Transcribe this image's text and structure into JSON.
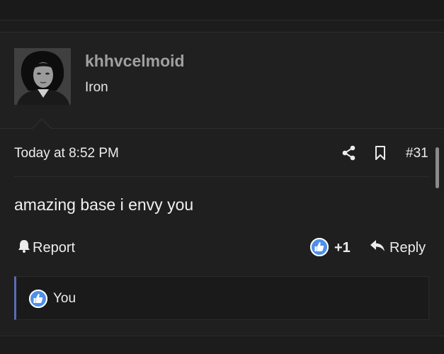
{
  "author": {
    "username": "khhvcelmoid",
    "title": "Iron"
  },
  "post": {
    "timestamp": "Today at 8:52 PM",
    "post_number": "#31",
    "message": "amazing base i envy you"
  },
  "actions": {
    "report_label": "Report",
    "like_count": "+1",
    "reply_label": "Reply"
  },
  "reactions": {
    "by": "You"
  },
  "colors": {
    "background": "#1c1c1c",
    "accent_bar": "#5c6bb5",
    "like_blue": "#3b82f6"
  },
  "icons": [
    "share-icon",
    "bookmark-icon",
    "bell-icon",
    "like-icon",
    "reply-icon"
  ]
}
